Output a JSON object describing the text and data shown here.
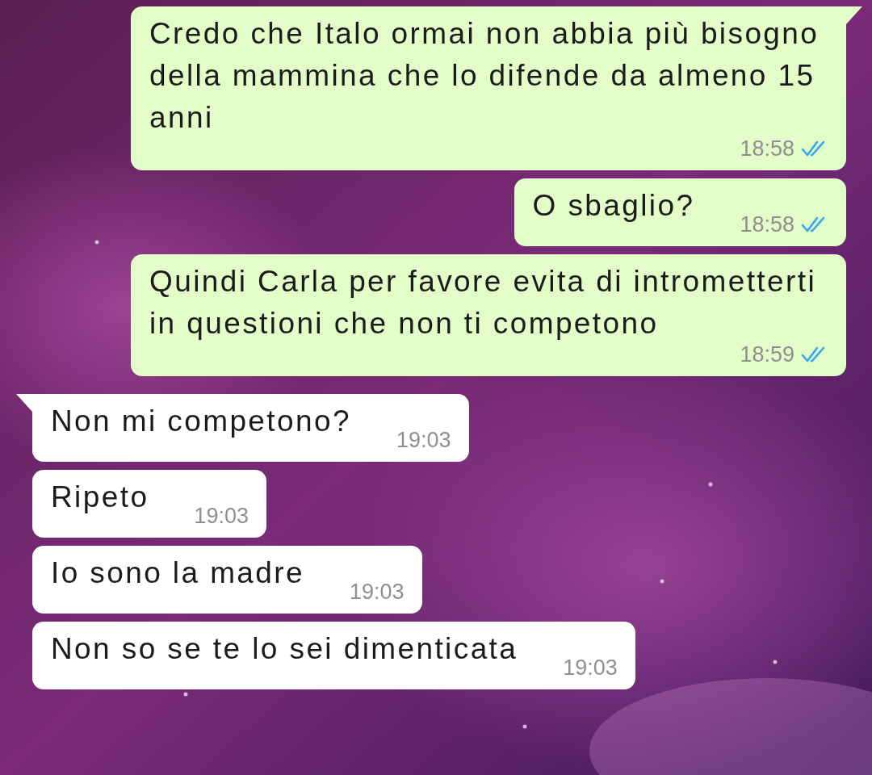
{
  "messages": [
    {
      "kind": "outgoing",
      "text": "Credo che Italo ormai non abbia più bisogno della mammina che lo difende da almeno 15 anni",
      "time": "18:58",
      "read": true,
      "tail": true
    },
    {
      "kind": "outgoing",
      "text": "O sbaglio?",
      "time": "18:58",
      "read": true,
      "tail": false
    },
    {
      "kind": "outgoing",
      "text": "Quindi Carla per favore evita di intrometterti in questioni che non ti competono",
      "time": "18:59",
      "read": true,
      "tail": false
    },
    {
      "kind": "incoming",
      "text": "Non mi competono?",
      "time": "19:03",
      "tail": true
    },
    {
      "kind": "incoming",
      "text": "Ripeto",
      "time": "19:03",
      "tail": false
    },
    {
      "kind": "incoming",
      "text": "Io sono la madre",
      "time": "19:03",
      "tail": false
    },
    {
      "kind": "incoming",
      "text": "Non so se te lo sei dimenticata",
      "time": "19:03",
      "tail": false
    }
  ]
}
